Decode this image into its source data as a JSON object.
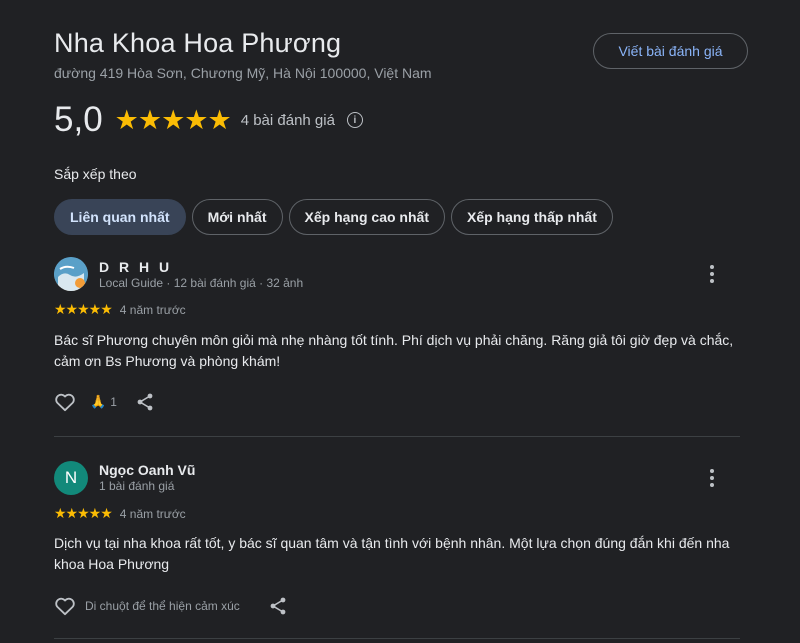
{
  "place": {
    "title": "Nha Khoa Hoa Phương",
    "address": "đường 419 Hòa Sơn, Chương Mỹ, Hà Nội 100000, Việt Nam"
  },
  "write_review_label": "Viết bài đánh giá",
  "summary": {
    "score": "5,0",
    "stars": "★★★★★",
    "count_label": "4 bài đánh giá",
    "info_icon": "i"
  },
  "sort": {
    "label": "Sắp xếp theo",
    "chips": [
      "Liên quan nhất",
      "Mới nhất",
      "Xếp hạng cao nhất",
      "Xếp hạng thấp nhất"
    ],
    "active_index": 0
  },
  "reviews": [
    {
      "name": "D R H U",
      "meta": "Local Guide · 12 bài đánh giá · 32 ảnh",
      "stars": "★★★★★",
      "time": "4 năm trước",
      "text": "Bác sĩ Phương chuyên môn giỏi mà nhẹ nhàng tốt tính. Phí dịch vụ phải chăng. Răng giả tôi giờ đẹp và chắc, cảm ơn Bs Phương và phòng khám!",
      "reaction_emoji": "🙏",
      "reaction_count": "1"
    },
    {
      "name": "Ngọc Oanh Vũ",
      "avatar_letter": "N",
      "meta": "1 bài đánh giá",
      "stars": "★★★★★",
      "time": "4 năm trước",
      "text": "Dịch vụ tại nha khoa rất tốt, y bác sĩ quan tâm và tận tình với bệnh nhân. Một lựa chọn đúng đắn khi đến nha khoa Hoa Phương",
      "reaction_hint": "Di chuột để thể hiện cảm xúc"
    }
  ],
  "colors": {
    "background": "#202124",
    "accent_link": "#8ab4f8",
    "star": "#fbbc04",
    "active_chip": "#394457",
    "avatar_n": "#12897a"
  },
  "icons": [
    "info-icon",
    "more-vert-icon",
    "heart-icon",
    "share-icon"
  ]
}
